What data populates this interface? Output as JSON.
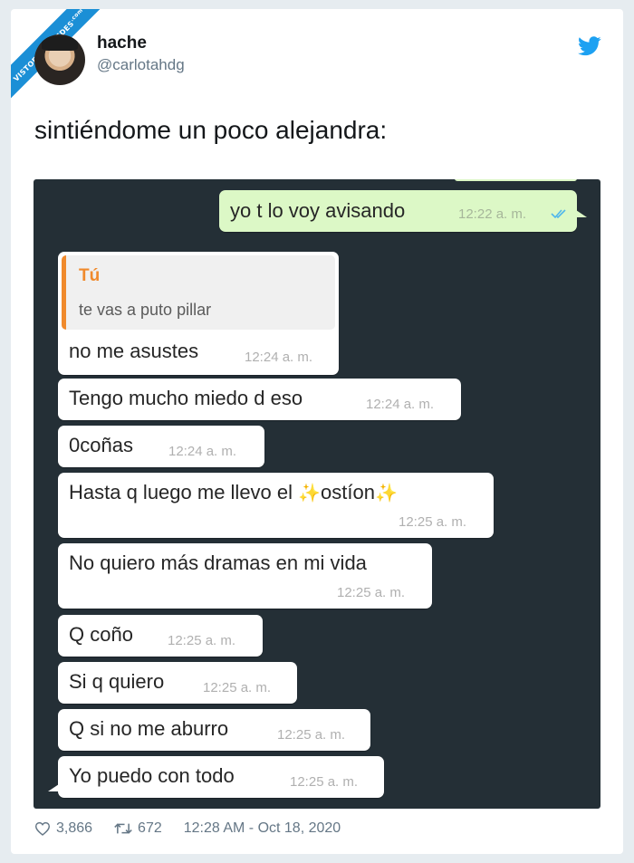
{
  "watermark": {
    "text": "VISTOENLASREDES",
    "suffix": ".com"
  },
  "user": {
    "name": "hache",
    "handle": "@carlotahdg"
  },
  "tweet": {
    "text": "sintiéndome un poco alejandra:"
  },
  "icons": {
    "brand": "twitter-bird-icon",
    "likes": "heart-icon",
    "retweets": "retweet-icon",
    "read": "double-check-icon"
  },
  "colors": {
    "chat_bg": "#242f36",
    "outgoing": "#dcf8c6",
    "incoming": "#ffffff",
    "quote_bar": "#f08a2c",
    "twitter_blue": "#1da1f2"
  },
  "chat": {
    "outgoing": {
      "text": "yo t lo voy avisando",
      "time": "12:22 a. m."
    },
    "quote": {
      "author": "Tú",
      "text": "te vas a puto pillar"
    },
    "messages": [
      {
        "text": "no me asustes",
        "time": "12:24 a. m."
      },
      {
        "text": "Tengo mucho miedo d eso",
        "time": "12:24 a. m."
      },
      {
        "text": "0coñas",
        "time": "12:24 a. m."
      },
      {
        "text_before": "Hasta q luego me llevo el ",
        "text_after": "ostíon",
        "time": "12:25 a. m."
      },
      {
        "text": "No quiero más dramas en mi vida",
        "time": "12:25 a. m."
      },
      {
        "text": "Q coño",
        "time": "12:25 a. m."
      },
      {
        "text": "Si q quiero",
        "time": "12:25 a. m."
      },
      {
        "text": "Q si no me aburro",
        "time": "12:25 a. m."
      },
      {
        "text": "Yo puedo con todo",
        "time": "12:25 a. m."
      }
    ]
  },
  "footer": {
    "likes": "3,866",
    "retweets": "672",
    "timestamp": "12:28 AM - Oct 18, 2020"
  }
}
